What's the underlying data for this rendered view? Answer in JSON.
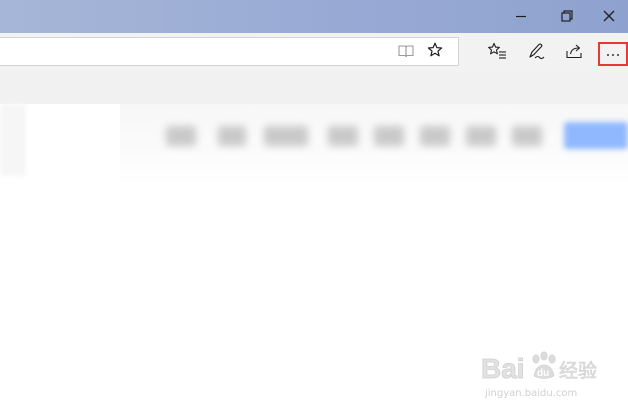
{
  "titlebar": {
    "buttons": [
      {
        "icon": "minimize-icon"
      },
      {
        "icon": "restore-icon"
      },
      {
        "icon": "close-icon"
      }
    ]
  },
  "toolbar": {
    "address": {
      "value": ""
    },
    "address_icons": [
      "reading-view-icon",
      "star-icon"
    ],
    "icons": [
      "favorites-hub-icon",
      "pen-icon",
      "share-icon",
      "more-icon"
    ],
    "highlight_color": "#e53935"
  },
  "page": {
    "nav_items": [
      "",
      "",
      "",
      "",
      "",
      "",
      "",
      ""
    ],
    "button_label": "",
    "accent_color": "#8fb8ff"
  },
  "watermark": {
    "logo": "Bai经验",
    "subtitle": "jingyan.baidu.com"
  }
}
